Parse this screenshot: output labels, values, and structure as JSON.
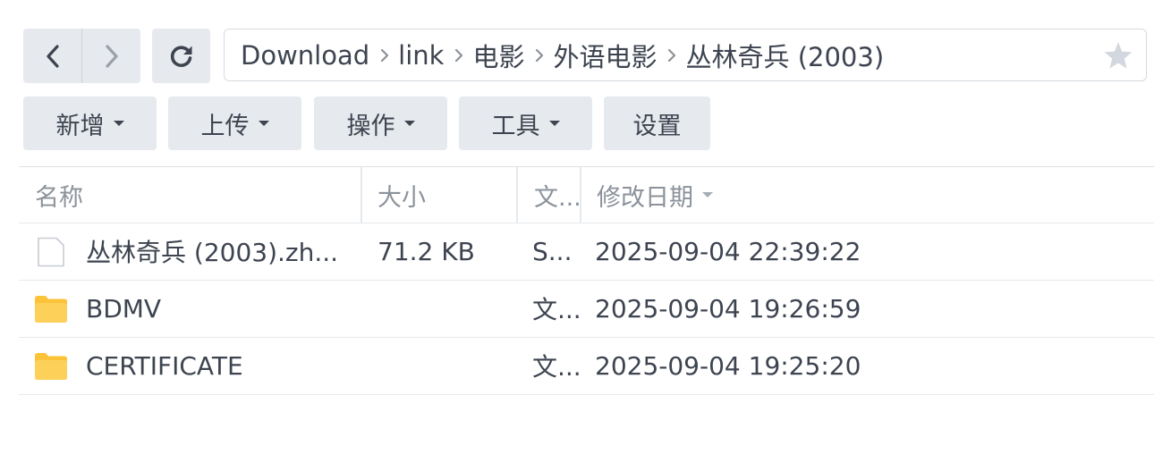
{
  "nav": {
    "back": "back-chevron-icon",
    "forward": "forward-chevron-icon",
    "refresh": "refresh-icon"
  },
  "path": {
    "crumbs": [
      "Download",
      "link",
      "电影",
      "外语电影",
      "丛林奇兵 (2003)"
    ],
    "favorite_icon": "star-icon"
  },
  "toolbar": {
    "new_label": "新增",
    "upload_label": "上传",
    "action_label": "操作",
    "tools_label": "工具",
    "settings_label": "设置"
  },
  "table": {
    "columns": {
      "name": "名称",
      "size": "大小",
      "type": "文...",
      "modified": "修改日期"
    },
    "rows": [
      {
        "icon": "file-icon",
        "name": "丛林奇兵 (2003).zh...",
        "size": "71.2 KB",
        "type": "S...",
        "modified": "2025-09-04 22:39:22"
      },
      {
        "icon": "folder-icon",
        "name": "BDMV",
        "size": "",
        "type": "文...",
        "modified": "2025-09-04 19:26:59"
      },
      {
        "icon": "folder-icon",
        "name": "CERTIFICATE",
        "size": "",
        "type": "文...",
        "modified": "2025-09-04 19:25:20"
      }
    ]
  },
  "colors": {
    "button_bg": "#e6e9ed",
    "folder": "#fcc339",
    "text": "#3d4450",
    "muted": "#8b929a"
  }
}
